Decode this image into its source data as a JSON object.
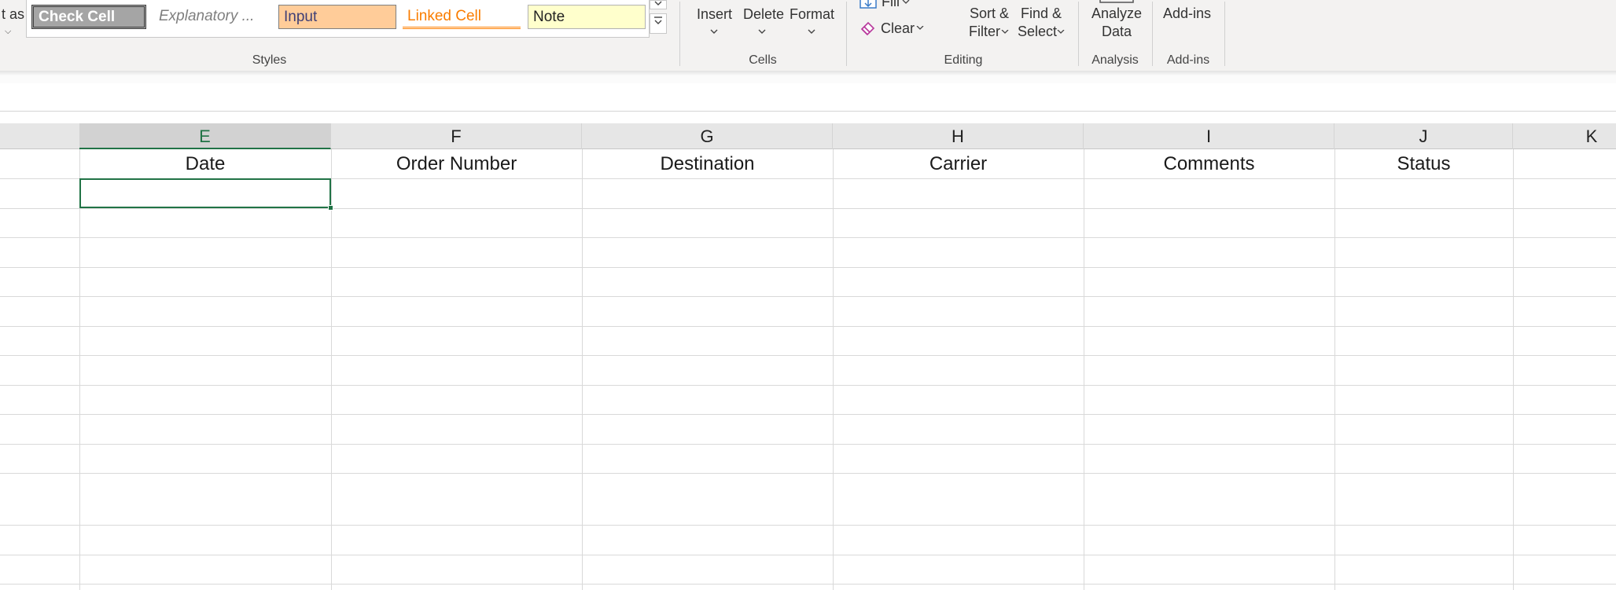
{
  "ribbon": {
    "format_as_fragment": "t as",
    "styles": {
      "group_label": "Styles",
      "check_cell": "Check Cell",
      "explanatory": "Explanatory ...",
      "input": "Input",
      "linked_cell": "Linked Cell",
      "note": "Note"
    },
    "cells": {
      "group_label": "Cells",
      "insert": "Insert",
      "delete": "Delete",
      "format": "Format"
    },
    "editing": {
      "group_label": "Editing",
      "fill": "Fill",
      "clear": "Clear",
      "sort_filter_line1": "Sort &",
      "sort_filter_line2": "Filter",
      "find_select_line1": "Find &",
      "find_select_line2": "Select"
    },
    "analysis": {
      "group_label": "Analysis",
      "analyze_line1": "Analyze",
      "analyze_line2": "Data"
    },
    "addins": {
      "group_label": "Add-ins",
      "addins_button": "Add-ins"
    }
  },
  "grid": {
    "column_letters": [
      "E",
      "F",
      "G",
      "H",
      "I",
      "J",
      "K"
    ],
    "selected_column": "E",
    "header_row": [
      "Date",
      "Order Number",
      "Destination",
      "Carrier",
      "Comments",
      "Status"
    ],
    "active_cell_value": ""
  },
  "colors": {
    "excel_green": "#217346",
    "check_cell_bg": "#a5a5a5",
    "input_bg": "#ffcc99",
    "note_bg": "#ffffcc",
    "linked_cell_fg": "#fa7d00"
  },
  "icons": [
    "chevron-down-icon",
    "fill-down-icon",
    "eraser-icon",
    "more-styles-icon"
  ]
}
